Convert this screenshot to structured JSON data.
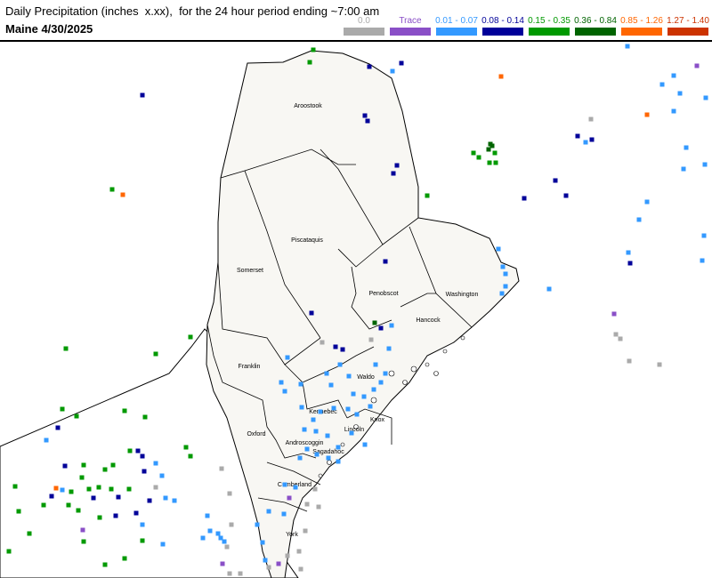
{
  "header": {
    "title": "Daily Precipitation (inches  x.xx),  for the 24 hour period ending ~7:00 am",
    "subtitle": "Maine 4/30/2025"
  },
  "legend": [
    {
      "label": "0.0",
      "color": "#aaaaaa"
    },
    {
      "label": "Trace",
      "color": "#8a4fc7"
    },
    {
      "label": "0.01 - 0.07",
      "color": "#3399ff"
    },
    {
      "label": "0.08 - 0.14",
      "color": "#000099"
    },
    {
      "label": "0.15 - 0.35",
      "color": "#009900"
    },
    {
      "label": "0.36 - 0.84",
      "color": "#006400"
    },
    {
      "label": "0.85 - 1.26",
      "color": "#ff6600"
    },
    {
      "label": "1.27 - 1.40",
      "color": "#cc3300"
    }
  ],
  "counties": [
    "Aroostook",
    "Piscataquis",
    "Somerset",
    "Penobscot",
    "Washington",
    "Hancock",
    "Franklin",
    "Waldo",
    "Kennebec",
    "Knox",
    "Oxford",
    "Lincoln",
    "Androscoggin",
    "Sagadahoc",
    "Cumberland",
    "York"
  ],
  "colors": {
    "land": "#f8f7f3",
    "water": "#ffffff",
    "border": "#000000"
  }
}
